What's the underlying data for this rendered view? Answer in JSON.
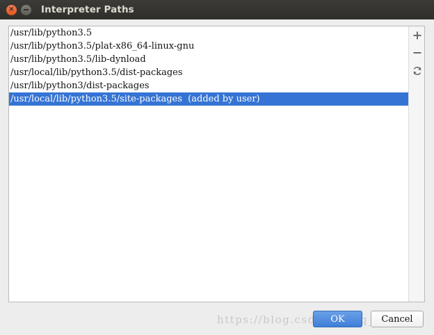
{
  "window": {
    "title": "Interpreter Paths",
    "close_glyph": "×"
  },
  "paths": [
    {
      "path": "/usr/lib/python3.5",
      "selected": false
    },
    {
      "path": "/usr/lib/python3.5/plat-x86_64-linux-gnu",
      "selected": false
    },
    {
      "path": "/usr/lib/python3.5/lib-dynload",
      "selected": false
    },
    {
      "path": "/usr/local/lib/python3.5/dist-packages",
      "selected": false
    },
    {
      "path": "/usr/lib/python3/dist-packages",
      "selected": false
    },
    {
      "path": "/usr/local/lib/python3.5/site-packages  (added by user)",
      "selected": true
    }
  ],
  "toolbar": {
    "add_icon": "plus-icon",
    "remove_icon": "minus-icon",
    "reload_icon": "reload-icon"
  },
  "buttons": {
    "ok_label": "OK",
    "cancel_label": "Cancel"
  },
  "watermark": "https://blog.csdn.net/qq_2??m7",
  "colors": {
    "selection": "#3574d4",
    "ok_button": "#4f8ede",
    "titlebar": "#3c3b37",
    "close_button": "#ef6a3a"
  }
}
